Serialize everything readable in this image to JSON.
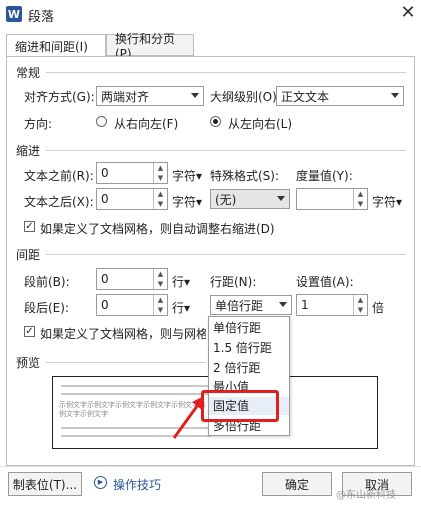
{
  "window": {
    "title": "段落",
    "app_icon": "W"
  },
  "tabs": [
    {
      "label": "缩进和间距(I)"
    },
    {
      "label": "换行和分页(P)"
    }
  ],
  "general": {
    "section": "常规",
    "align_label": "对齐方式(G):",
    "align_value": "两端对齐",
    "outline_label": "大纲级别(O):",
    "outline_value": "正文文本",
    "direction_label": "方向:",
    "rtl_label": "从右向左(F)",
    "ltr_label": "从左向右(L)",
    "direction_selected": "从左向右(L)"
  },
  "indent": {
    "section": "缩进",
    "before_label": "文本之前(R):",
    "before_value": "0",
    "before_unit": "字符▾",
    "after_label": "文本之后(X):",
    "after_value": "0",
    "after_unit": "字符▾",
    "special_label": "特殊格式(S):",
    "special_value": "(无)",
    "measure_label": "度量值(Y):",
    "measure_value": "",
    "measure_unit": "字符▾",
    "grid_check_label": "如果定义了文档网格，则自动调整右缩进(D)",
    "grid_checked": true
  },
  "spacing": {
    "section": "间距",
    "before_label": "段前(B):",
    "before_value": "0",
    "before_unit": "行▾",
    "after_label": "段后(E):",
    "after_value": "0",
    "after_unit": "行▾",
    "line_label": "行距(N):",
    "line_value": "单倍行距",
    "setting_label": "设置值(A):",
    "setting_value": "1",
    "setting_unit": "倍",
    "grid_check_label": "如果定义了文档网格，则与网格对齐",
    "grid_checked": true
  },
  "line_spacing_options": [
    "单倍行距",
    "1.5 倍行距",
    "2 倍行距",
    "最小值",
    "固定值",
    "多倍行距"
  ],
  "line_spacing_highlighted": "固定值",
  "preview": {
    "section": "预览",
    "sample": "示例文字示例文字示例文字示例文字示例文字示例文字示例文字"
  },
  "footer": {
    "tabs_button": "制表位(T)...",
    "tips_label": "操作技巧",
    "ok_button": "确定",
    "cancel_button": "取消",
    "watermark": "@东山新科技"
  },
  "colors": {
    "highlight": "#e02020",
    "accent": "#2b579a"
  }
}
